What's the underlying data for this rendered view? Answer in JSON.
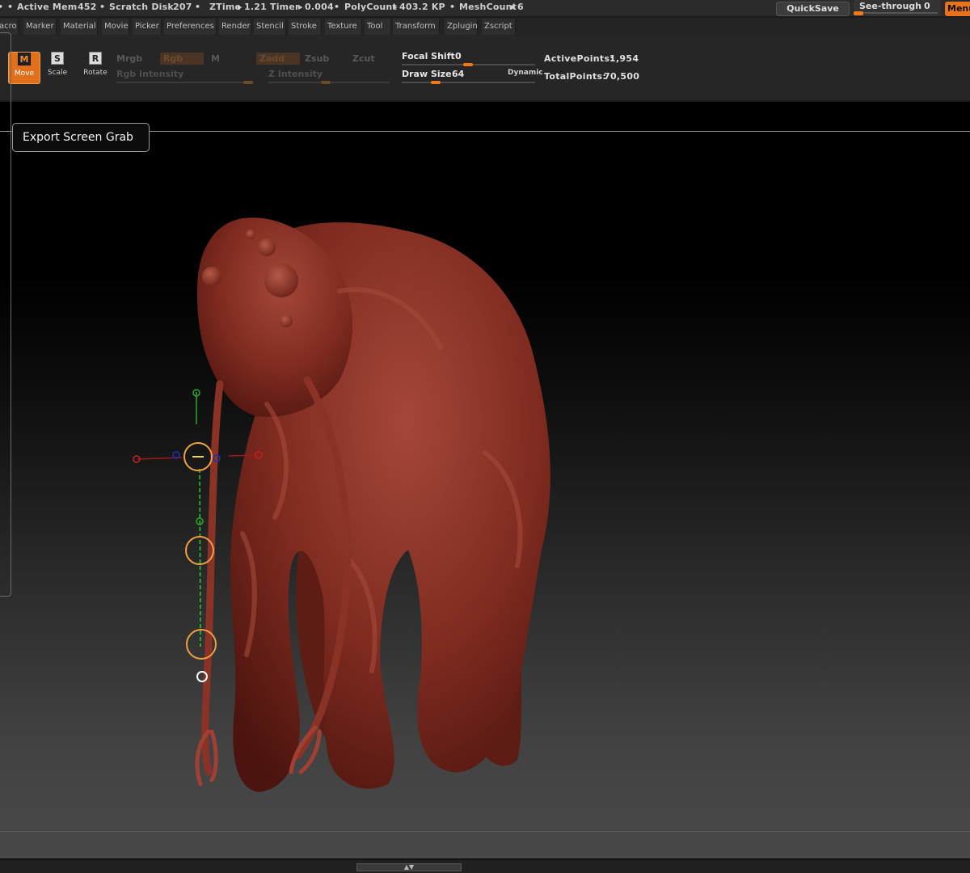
{
  "status_bar": {
    "active_mem_label": "Active Mem",
    "active_mem_value": "452",
    "scratch_disk_label": "Scratch Disk",
    "scratch_disk_value": "207",
    "ztime_label": "ZTime",
    "ztime_value": "1.21",
    "timer_label": "Timer",
    "timer_value": "0.004",
    "polycount_label": "PolyCount",
    "polycount_value": "403.2 KP",
    "meshcount_label": "MeshCount",
    "meshcount_value": "6",
    "bullet": "•",
    "arrow": "▸",
    "quicksave_label": "QuickSave",
    "see_through_label": "See-through",
    "see_through_value": "0",
    "menus_label": "Menus"
  },
  "menu_bar": {
    "items": [
      "acro",
      "Marker",
      "Material",
      "Movie",
      "Picker",
      "Preferences",
      "Render",
      "Stencil",
      "Stroke",
      "Texture",
      "Tool",
      "Transform",
      "Zplugin",
      "Zscript"
    ]
  },
  "shelf": {
    "move_label": "Move",
    "move_icon_letter": "M",
    "scale_label": "Scale",
    "scale_icon_letter": "S",
    "rotate_label": "Rotate",
    "rotate_icon_letter": "R",
    "mrgb_label": "Mrgb",
    "rgb_label": "Rgb",
    "m_label": "M",
    "zadd_label": "Zadd",
    "zsub_label": "Zsub",
    "zcut_label": "Zcut",
    "rgb_intensity_label": "Rgb Intensity",
    "z_intensity_label": "Z Intensity",
    "focal_shift_label": "Focal Shift",
    "focal_shift_value": "0",
    "draw_size_label": "Draw Size",
    "draw_size_value": "64",
    "dynamic_label": "Dynamic",
    "active_points_label": "ActivePoints:",
    "active_points_value": "1,954",
    "total_points_label": "TotalPoints:",
    "total_points_value": "70,500"
  },
  "viewport": {
    "tooltip_text": "Export Screen Grab"
  },
  "colors": {
    "accent": "#f07818",
    "model_clay": "#7f2b20",
    "viewport_bg_top": "#000000",
    "viewport_bg_bottom": "#474747"
  }
}
